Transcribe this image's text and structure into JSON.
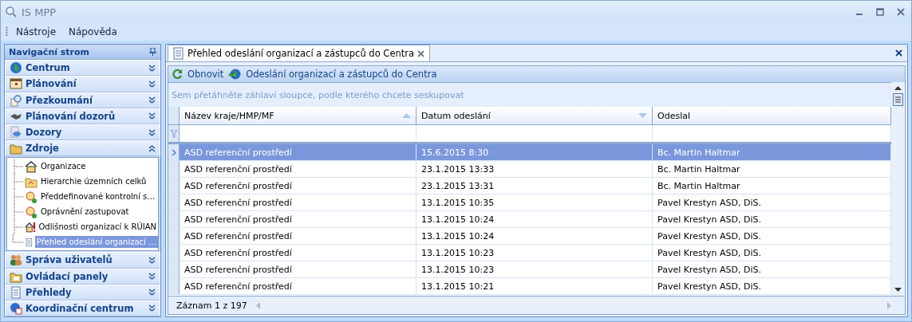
{
  "window": {
    "title": "IS MPP"
  },
  "menu": [
    "Nástroje",
    "Nápověda"
  ],
  "sidebar": {
    "title": "Navigační strom",
    "sections_before": [
      {
        "label": "Centrum",
        "expanded": false
      },
      {
        "label": "Plánování",
        "expanded": false
      },
      {
        "label": "Přezkoumání",
        "expanded": false
      },
      {
        "label": "Plánování dozorů",
        "expanded": false
      },
      {
        "label": "Dozory",
        "expanded": false
      },
      {
        "label": "Zdroje",
        "expanded": true,
        "children": [
          {
            "label": "Organizace",
            "selected": false
          },
          {
            "label": "Hierarchie územních celků",
            "selected": false
          },
          {
            "label": "Předdefinované kontrolní s…",
            "selected": false
          },
          {
            "label": "Oprávnění zastupovat",
            "selected": false
          },
          {
            "label": "Odlišnosti organizací k RÚIAN",
            "selected": false
          },
          {
            "label": "Přehled odeslání organizací …",
            "selected": true
          }
        ]
      }
    ],
    "sections_after": [
      {
        "label": "Správa uživatelů",
        "expanded": false
      },
      {
        "label": "Ovládací panely",
        "expanded": false
      },
      {
        "label": "Přehledy",
        "expanded": false
      },
      {
        "label": "Koordinační centrum",
        "expanded": false
      }
    ]
  },
  "tabs": [
    {
      "label": "Přehled odeslání organizací a zástupců do Centra",
      "selected": true
    }
  ],
  "toolbar": [
    "Obnovit",
    "Odeslání organizací a zástupců do Centra"
  ],
  "group_panel": {
    "placeholder": "Sem přetáhněte záhlaví sloupce, podle kterého chcete seskupovat"
  },
  "table": {
    "columns": [
      {
        "label": "Název kraje/HMP/MF",
        "sorted_ascending": true,
        "sorted_descending": false
      },
      {
        "label": "Datum odeslání",
        "sorted_ascending": false,
        "sorted_descending": true
      },
      {
        "label": "Odeslal",
        "sorted_ascending": false,
        "sorted_descending": false
      }
    ],
    "rows": [
      {
        "cells": [
          "ASD referenční prostředí",
          "15.6.2015 8:30",
          "Bc. Martin Haltmar"
        ],
        "selected": true
      },
      {
        "cells": [
          "ASD referenční prostředí",
          "23.1.2015 13:33",
          "Bc. Martin Haltmar"
        ],
        "selected": false
      },
      {
        "cells": [
          "ASD referenční prostředí",
          "23.1.2015 13:31",
          "Bc. Martin Haltmar"
        ],
        "selected": false
      },
      {
        "cells": [
          "ASD referenční prostředí",
          "13.1.2015 10:35",
          "Pavel Krestyn ASD, DiS."
        ],
        "selected": false
      },
      {
        "cells": [
          "ASD referenční prostředí",
          "13.1.2015 10:24",
          "Pavel Krestyn ASD, DiS."
        ],
        "selected": false
      },
      {
        "cells": [
          "ASD referenční prostředí",
          "13.1.2015 10:24",
          "Pavel Krestyn ASD, DiS."
        ],
        "selected": false
      },
      {
        "cells": [
          "ASD referenční prostředí",
          "13.1.2015 10:23",
          "Pavel Krestyn ASD, DiS."
        ],
        "selected": false
      },
      {
        "cells": [
          "ASD referenční prostředí",
          "13.1.2015 10:23",
          "Pavel Krestyn ASD, DiS."
        ],
        "selected": false
      },
      {
        "cells": [
          "ASD referenční prostředí",
          "13.1.2015 10:21",
          "Pavel Krestyn ASD, DiS."
        ],
        "selected": false
      }
    ],
    "footer": "Záznam 1 z 197"
  }
}
